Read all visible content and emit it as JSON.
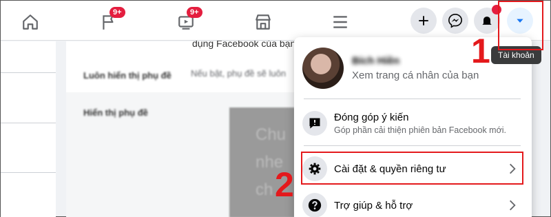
{
  "nav": {
    "home_icon": "home-icon",
    "pages_badge": "9+",
    "watch_badge": "9+",
    "marketplace_icon": "store-icon",
    "menu_icon": "hamburger-icon"
  },
  "background": {
    "top_text": "dụng Facebook của bạn",
    "row1_label": "Luôn hiển thị phụ đề",
    "row1_value": "Nếu bật, phụ đề sẽ luôn",
    "row2_label": "Hiển thị phụ đề",
    "img_text": "Chu nhe ch"
  },
  "profile": {
    "name": "Bích Hiền",
    "subtitle": "Xem trang cá nhân của bạn"
  },
  "menu": [
    {
      "title": "Đóng góp ý kiến",
      "desc": "Góp phần cải thiện phiên bản Facebook mới."
    },
    {
      "title": "Cài đặt & quyền riêng tư",
      "desc": ""
    },
    {
      "title": "Trợ giúp & hỗ trợ",
      "desc": ""
    }
  ],
  "tooltip": "Tài khoản",
  "annotations": {
    "step1": "1",
    "step2": "2"
  },
  "colors": {
    "accent": "#1877f2",
    "annotation": "#e4191c",
    "badge": "#e41e3f"
  }
}
